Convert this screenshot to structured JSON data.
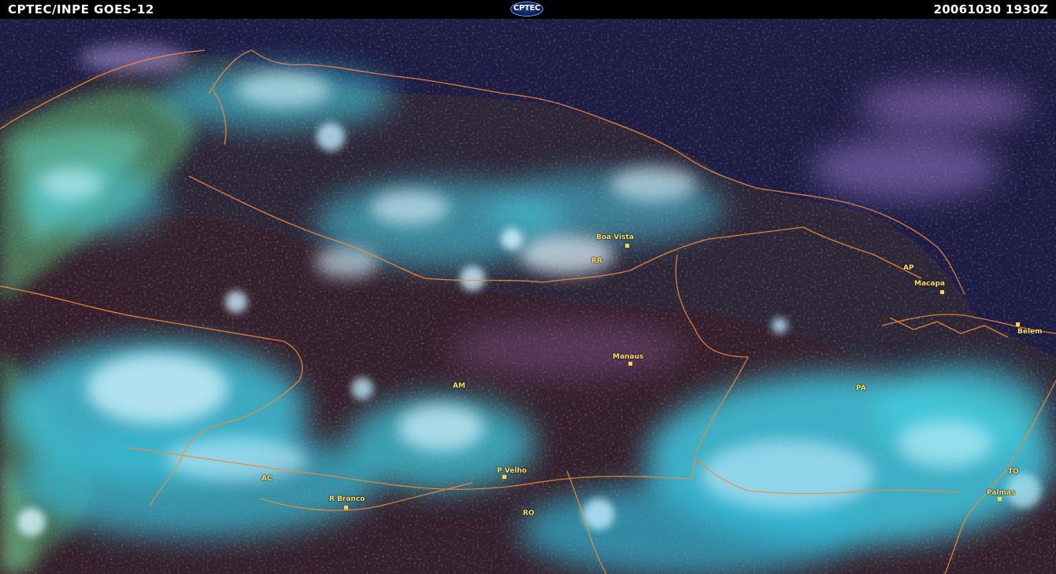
{
  "header": {
    "left_title": "CPTEC/INPE  GOES-12",
    "logo_text": "CPTEC",
    "right_timestamp": "20061030  1930Z"
  },
  "colors": {
    "background_sea": "#1c1c44",
    "land": "#2a2536",
    "forest": "#3a1f2a",
    "highlands_green": "#5fb87a",
    "cloud_cyan": "#4fd8e6",
    "cloud_white": "#d6f4ff",
    "cloud_violet": "#8878d0",
    "boundary": "#f08a3c",
    "label": "#ffe066"
  },
  "labels": {
    "boa_vista": "Boa Vista",
    "rr": "RR",
    "ap": "AP",
    "macapa": "Macapa",
    "belem": "Belem",
    "manaus": "Manaus",
    "am": "AM",
    "pa": "PA",
    "ac": "AC",
    "p_velho": "P Velho",
    "r_branco": "R Branco",
    "ro": "RO",
    "to": "TO",
    "palmas": "Palmas"
  }
}
